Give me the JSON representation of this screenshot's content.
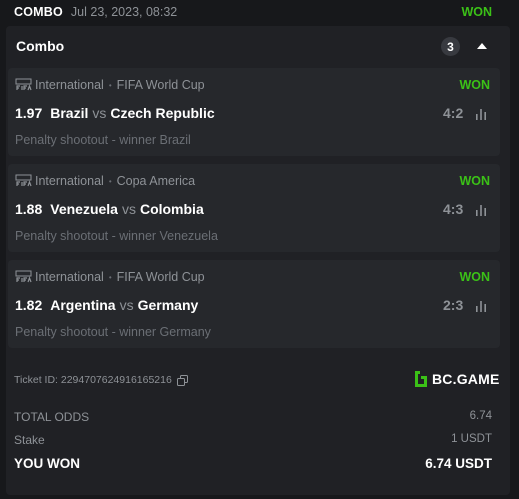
{
  "header": {
    "bet_type": "COMBO",
    "date": "Jul 23, 2023, 08:32",
    "status": "WON"
  },
  "combo": {
    "title": "Combo",
    "count": "3"
  },
  "legs": [
    {
      "category": "International",
      "tournament": "FIFA World Cup",
      "status": "WON",
      "odds": "1.97",
      "home": "Brazil",
      "vs": "vs",
      "away": "Czech Republic",
      "score": "4:2",
      "result": "Penalty shootout - winner Brazil"
    },
    {
      "category": "International",
      "tournament": "Copa America",
      "status": "WON",
      "odds": "1.88",
      "home": "Venezuela",
      "vs": "vs",
      "away": "Colombia",
      "score": "4:3",
      "result": "Penalty shootout - winner Venezuela"
    },
    {
      "category": "International",
      "tournament": "FIFA World Cup",
      "status": "WON",
      "odds": "1.82",
      "home": "Argentina",
      "vs": "vs",
      "away": "Germany",
      "score": "2:3",
      "result": "Penalty shootout - winner Germany"
    }
  ],
  "ticket": {
    "id_text": "Ticket ID: 2294707624916165216",
    "brand": "BC.GAME"
  },
  "summary": {
    "total_odds_label": "TOTAL ODDS",
    "total_odds_value": "6.74",
    "stake_label": "Stake",
    "stake_value": "1 USDT",
    "won_label": "YOU WON",
    "won_value": "6.74 USDT"
  },
  "colors": {
    "won": "#3bc117",
    "background": "#17181b",
    "panel": "#202125",
    "card": "#26282c",
    "muted": "#8e9297"
  },
  "icons": {
    "league": "fifa-icon",
    "stats": "bar-chart-icon",
    "copy": "copy-icon",
    "collapse": "chevron-up-icon",
    "brand": "bc-game-logo"
  }
}
